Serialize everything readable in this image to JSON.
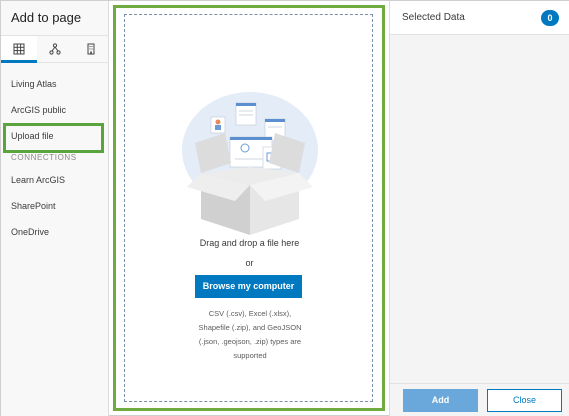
{
  "panel": {
    "title": "Add to page"
  },
  "tabs": [
    {
      "icon": "grid-icon",
      "active": true
    },
    {
      "icon": "hierarchy-icon",
      "active": false
    },
    {
      "icon": "building-icon",
      "active": false
    }
  ],
  "nav": {
    "items": [
      "Living Atlas",
      "ArcGIS public",
      "Upload file"
    ],
    "section_label": "CONNECTIONS",
    "connections": [
      "Learn ArcGIS",
      "SharePoint",
      "OneDrive"
    ],
    "selected": "Upload file"
  },
  "dropzone": {
    "drag_text": "Drag and drop a file here",
    "or_text": "or",
    "browse_label": "Browse my computer",
    "types_lines": [
      "CSV (.csv), Excel (.xlsx),",
      "Shapefile (.zip), and GeoJSON",
      "(.json, .geojson, .zip) types are",
      "supported"
    ]
  },
  "selected": {
    "title": "Selected Data",
    "count": "0"
  },
  "footer": {
    "add_label": "Add",
    "close_label": "Close"
  },
  "colors": {
    "accent": "#0079c1",
    "highlight": "#5aa43e",
    "add_disabled": "#6aa8dc"
  }
}
